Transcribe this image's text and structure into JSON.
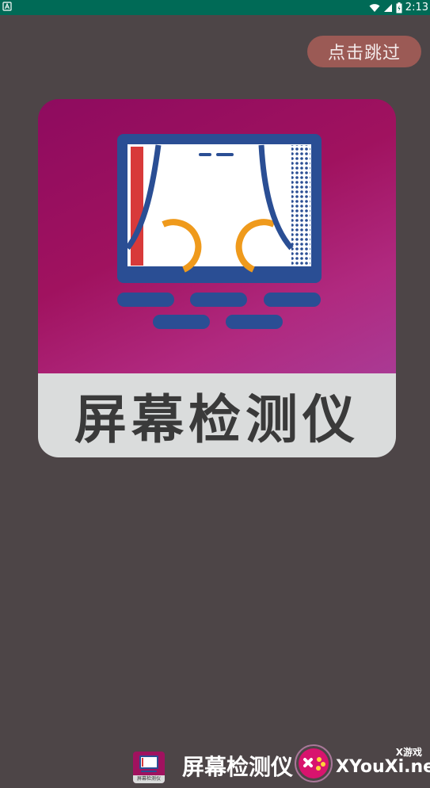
{
  "status_bar": {
    "time": "2:13",
    "left_icon": "notification-a-icon",
    "icons": [
      "wifi-icon",
      "signal-icon",
      "battery-icon"
    ]
  },
  "skip": {
    "label": "点击跳过"
  },
  "logo": {
    "title": "屏幕检测仪",
    "top_color": "#a0125f",
    "bottom_color": "#dadcdc"
  },
  "footer": {
    "app_name": "屏幕检测仪",
    "small_icon_label": "屏幕检测仪"
  },
  "watermark": {
    "top_text": "X游戏",
    "main_text": "XYouXi.net"
  },
  "colors": {
    "background": "#4d4547",
    "status_bar": "#006a56",
    "skip_button": "#9b5a55"
  }
}
